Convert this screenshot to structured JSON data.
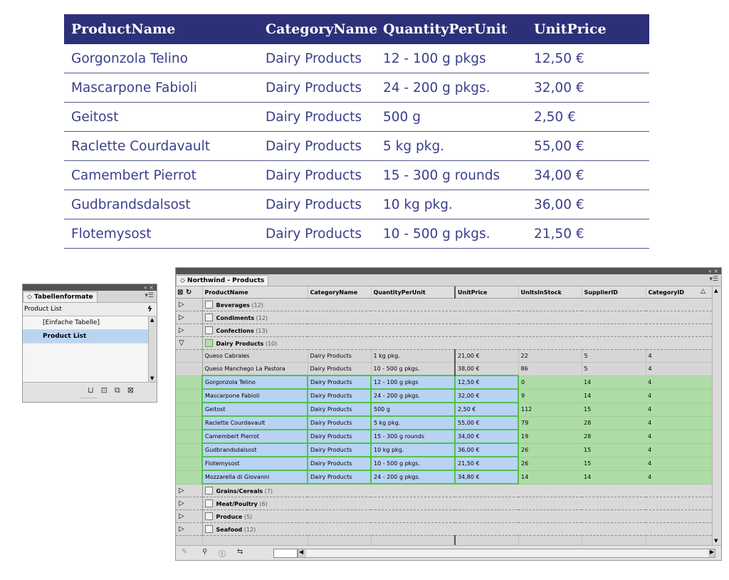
{
  "doc_table": {
    "headers": [
      "ProductName",
      "CategoryName",
      "QuantityPerUnit",
      "UnitPrice"
    ],
    "rows": [
      [
        "Gorgonzola Telino",
        "Dairy Products",
        "12 - 100 g pkgs",
        "12,50 €"
      ],
      [
        "Mascarpone Fabioli",
        "Dairy Products",
        "24 - 200 g pkgs.",
        "32,00 €"
      ],
      [
        "Geitost",
        "Dairy Products",
        "500 g",
        "2,50 €"
      ],
      [
        "Raclette Courdavault",
        "Dairy Products",
        "5 kg pkg.",
        "55,00 €"
      ],
      [
        "Camembert Pierrot",
        "Dairy Products",
        "15 - 300 g rounds",
        "34,00 €"
      ],
      [
        "Gudbrandsdalsost",
        "Dairy Products",
        "10 kg pkg.",
        "36,00 €"
      ],
      [
        "Flotemysost",
        "Dairy Products",
        "10 - 500 g pkgs.",
        "21,50 €"
      ]
    ],
    "colors": {
      "header_bg": "#2c3079",
      "text": "#3b3f8a"
    }
  },
  "styles_panel": {
    "top_controls": "«  ×",
    "tab_title": "◇ Tabellenformate",
    "current_style": "Product List",
    "lightning_icon": "ϟ",
    "items": [
      {
        "label": "[Einfache Tabelle]",
        "selected": false
      },
      {
        "label": "Product List",
        "selected": true
      }
    ],
    "bottom_icons": [
      "folder-icon",
      "new-style-icon",
      "duplicate-icon",
      "trash-icon"
    ]
  },
  "data_panel": {
    "top_controls": "«  ×",
    "tab_title": "◇ Northwind - Products",
    "columns": [
      "ProductName",
      "CategoryName",
      "QuantityPerUnit",
      "UnitPrice",
      "UnitsInStock",
      "SupplierID",
      "CategoryID"
    ],
    "groups_before": [
      {
        "name": "Beverages",
        "count": "(12)"
      },
      {
        "name": "Condiments",
        "count": "(12)"
      },
      {
        "name": "Confections",
        "count": "(13)"
      }
    ],
    "expanded_group": {
      "name": "Dairy Products",
      "count": "(10)"
    },
    "rows": [
      {
        "cells": [
          "Queso Cabrales",
          "Dairy Products",
          "1 kg pkg.",
          "21,00 €",
          "22",
          "5",
          "4"
        ],
        "highlight": false
      },
      {
        "cells": [
          "Queso Manchego La Pastora",
          "Dairy Products",
          "10 - 500 g pkgs.",
          "38,00 €",
          "86",
          "5",
          "4"
        ],
        "highlight": false
      },
      {
        "cells": [
          "Gorgonzola Telino",
          "Dairy Products",
          "12 - 100 g pkgs",
          "12,50 €",
          "0",
          "14",
          "4"
        ],
        "highlight": true
      },
      {
        "cells": [
          "Mascarpone Fabioli",
          "Dairy Products",
          "24 - 200 g pkgs.",
          "32,00 €",
          "9",
          "14",
          "4"
        ],
        "highlight": true
      },
      {
        "cells": [
          "Geitost",
          "Dairy Products",
          "500 g",
          "2,50 €",
          "112",
          "15",
          "4"
        ],
        "highlight": true
      },
      {
        "cells": [
          "Raclette Courdavault",
          "Dairy Products",
          "5 kg pkg.",
          "55,00 €",
          "79",
          "28",
          "4"
        ],
        "highlight": true
      },
      {
        "cells": [
          "Camembert Pierrot",
          "Dairy Products",
          "15 - 300 g rounds",
          "34,00 €",
          "19",
          "28",
          "4"
        ],
        "highlight": true
      },
      {
        "cells": [
          "Gudbrandsdalsost",
          "Dairy Products",
          "10 kg pkg.",
          "36,00 €",
          "26",
          "15",
          "4"
        ],
        "highlight": true
      },
      {
        "cells": [
          "Flotemysost",
          "Dairy Products",
          "10 - 500 g pkgs.",
          "21,50 €",
          "26",
          "15",
          "4"
        ],
        "highlight": true
      },
      {
        "cells": [
          "Mozzarella di Giovanni",
          "Dairy Products",
          "24 - 200 g pkgs.",
          "34,80 €",
          "14",
          "14",
          "4"
        ],
        "highlight": true
      }
    ],
    "groups_after": [
      {
        "name": "Grains/Cereals",
        "count": "(7)"
      },
      {
        "name": "Meat/Poultry",
        "count": "(6)"
      },
      {
        "name": "Produce",
        "count": "(5)"
      },
      {
        "name": "Seafood",
        "count": "(12)"
      }
    ],
    "icons": {
      "collapsed": "▷",
      "expanded": "▽",
      "select_all": "⊠",
      "refresh": "↻",
      "sort": "△",
      "pencil": "✎",
      "search": "⚲",
      "info": "ⓘ",
      "swap": "⇆",
      "scroll_left": "◀",
      "scroll_right": "▶"
    },
    "colors": {
      "highlight_row": "#aedca6",
      "highlight_cell": "#b8d3f3",
      "cell_border": "#53c14e"
    }
  }
}
